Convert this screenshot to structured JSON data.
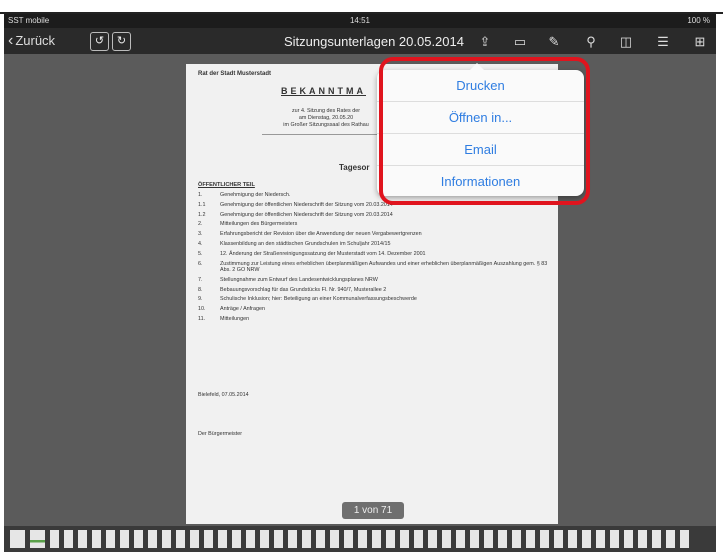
{
  "status": {
    "carrier": "SST mobile",
    "time": "14:51",
    "battery": "100 %"
  },
  "nav": {
    "back_label": "Zurück",
    "undo_icon": "undo-icon",
    "redo_icon": "redo-icon",
    "title": "Sitzungsunterlagen 20.05.2014",
    "icons": [
      "share-icon",
      "comment-icon",
      "edit-icon",
      "search-icon",
      "book-icon",
      "list-icon",
      "grid-icon"
    ]
  },
  "document": {
    "org": "Rat der Stadt Musterstadt",
    "heading": "BEKANNTMA",
    "sub": [
      "zur 4. Sitzung des Rates der",
      "am Dienstag, 20.05.20",
      "im Großer Sitzungssaal des Rathau"
    ],
    "agenda_title": "Tagesor",
    "section": "ÖFFENTLICHER TEIL",
    "items": [
      {
        "n": "1.",
        "t": "Genehmigung der Niedersch."
      },
      {
        "n": "1.1",
        "t": "Genehmigung der öffentlichen Niederschrift der Sitzung vom 20.03.2014"
      },
      {
        "n": "1.2",
        "t": "Genehmigung der öffentlichen Niederschrift der Sitzung vom 20.03.2014"
      },
      {
        "n": "2.",
        "t": "Mitteilungen des Bürgermeisters"
      },
      {
        "n": "3.",
        "t": "Erfahrungsbericht der Revision über die Anwendung der neuen Vergabewertgrenzen"
      },
      {
        "n": "4.",
        "t": "Klassenbildung an den städtischen Grundschulen im Schuljahr 2014/15"
      },
      {
        "n": "5.",
        "t": "12. Änderung der Straßenreinigungssatzung der Musterstadt vom 14. Dezember 2001"
      },
      {
        "n": "6.",
        "t": "Zustimmung zur Leistung eines erheblichen überplanmäßigen Aufwandes und einer erheblichen überplanmäßigen Auszahlung gem. § 83 Abs. 2 GO NRW"
      },
      {
        "n": "7.",
        "t": "Stellungnahme zum Entwurf des Landesentwicklungsplanes NRW"
      },
      {
        "n": "8.",
        "t": "Bebauungsvorschlag für das Grundstücks Fl. Nr. 940/7, Musterallee 2"
      },
      {
        "n": "9.",
        "t": "Schulische Inklusion; hier: Beteiligung an einer Kommunalverfassungsbeschwerde"
      },
      {
        "n": "10.",
        "t": "Anträge / Anfragen"
      },
      {
        "n": "11.",
        "t": "Mitteilungen"
      }
    ],
    "date": "Bielefeld, 07.05.2014",
    "signature": "Der Bürgermeister"
  },
  "page_indicator": "1 von 71",
  "popover": {
    "items": [
      "Drucken",
      "Öffnen in...",
      "Email",
      "Informationen"
    ]
  },
  "colors": {
    "accent": "#2f7de1",
    "highlight": "#e0141e"
  }
}
